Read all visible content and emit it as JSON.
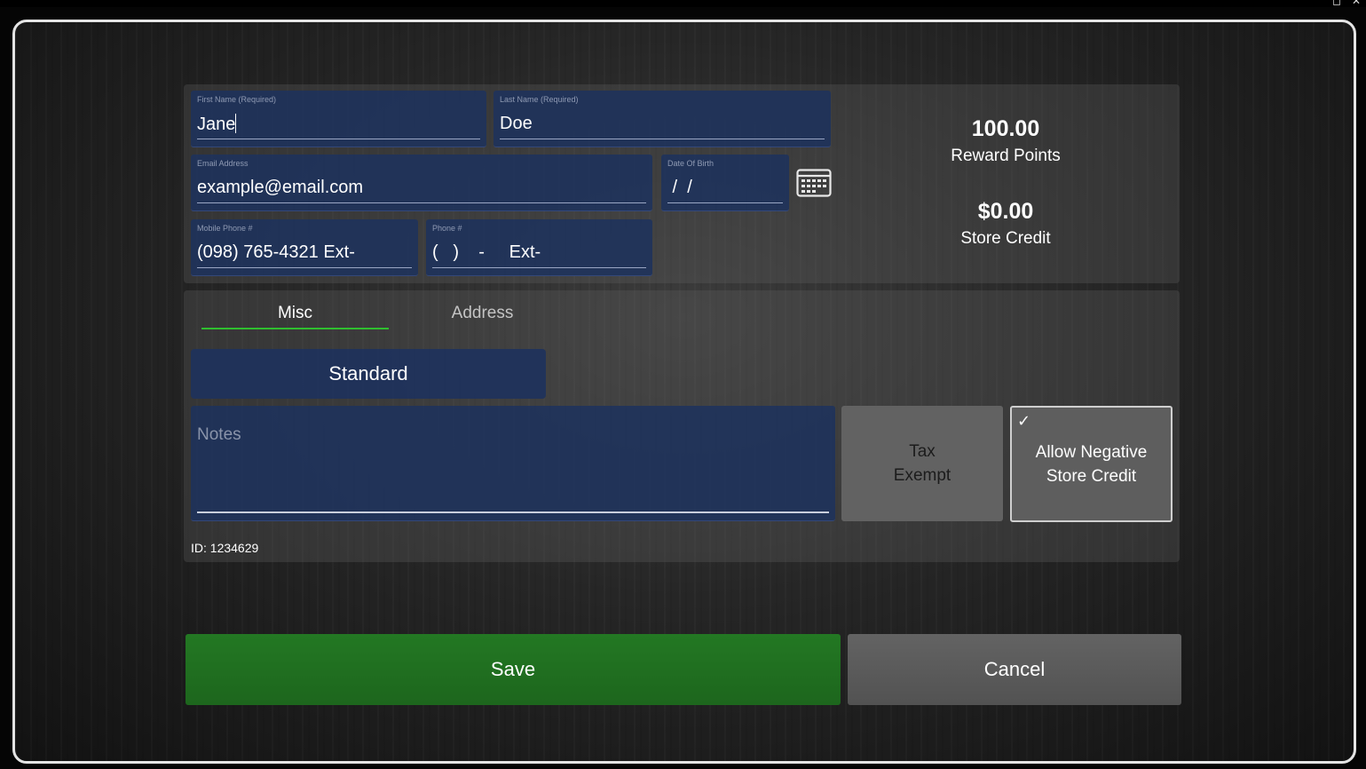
{
  "window": {
    "restore_glyph": "◻",
    "close_glyph": "✕"
  },
  "stats": {
    "reward_points_value": "100.00",
    "reward_points_label": "Reward Points",
    "store_credit_value": "$0.00",
    "store_credit_label": "Store Credit"
  },
  "fields": {
    "first_name": {
      "label": "First Name (Required)",
      "value": "Jane"
    },
    "last_name": {
      "label": "Last Name (Required)",
      "value": "Doe"
    },
    "email": {
      "label": "Email Address",
      "value": "example@email.com"
    },
    "dob": {
      "label": "Date Of Birth",
      "value": " /  /"
    },
    "mobile_phone": {
      "label": "Mobile Phone #",
      "value": "(098) 765-4321 Ext-"
    },
    "phone": {
      "label": "Phone #",
      "value": "(   )    -     Ext-"
    }
  },
  "tabs": [
    {
      "label": "Misc",
      "active": true
    },
    {
      "label": "Address",
      "active": false
    }
  ],
  "customer_type": "Standard",
  "notes": {
    "placeholder": "Notes",
    "value": ""
  },
  "toggles": {
    "tax_exempt": {
      "label_line1": "Tax",
      "label_line2": "Exempt",
      "checked": false
    },
    "allow_negative": {
      "label_line1": "Allow Negative",
      "label_line2": "Store Credit",
      "checked": true,
      "check_glyph": "✓"
    }
  },
  "customer_id": "ID: 1234629",
  "actions": {
    "save": "Save",
    "cancel": "Cancel"
  },
  "icons": {
    "calendar": "calendar-icon",
    "check": "check-icon"
  },
  "colors": {
    "field_bg": "#1e325c",
    "save_green": "#1f6e1f",
    "cancel_gray": "#5a5a5a",
    "tab_underline": "#2fbf2f"
  }
}
